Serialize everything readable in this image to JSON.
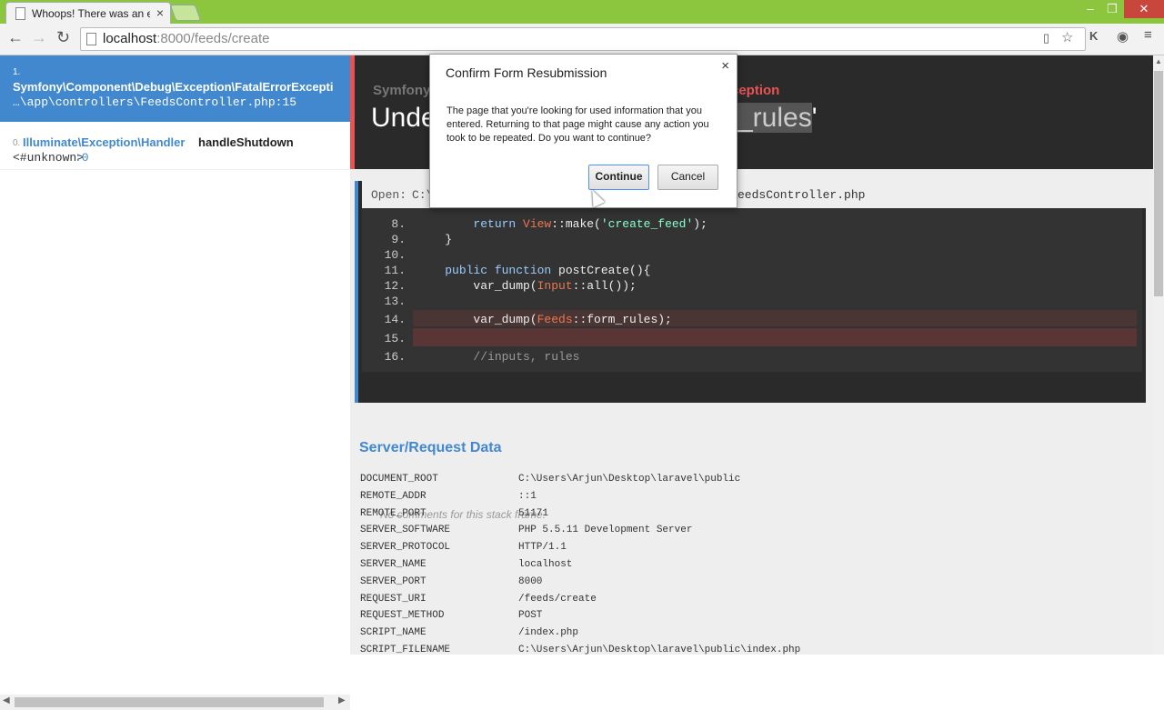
{
  "tab": {
    "title": "Whoops! There was an err"
  },
  "address": {
    "host": "localhost",
    "rest": ":8000/feeds/create"
  },
  "frames": [
    {
      "num": "1.",
      "cls": "Symfony\\Component\\Debug\\Exception\\FatalErrorExcepti",
      "file": "…\\app\\controllers\\FeedsController.php:15"
    },
    {
      "num": "0.",
      "cls": "Illuminate\\Exception\\Handler",
      "method": "handleShutdown",
      "file": "<#unknown>",
      "line": ":0"
    }
  ],
  "header": {
    "class_prefix": "Symfony",
    "class_suffix": "ception",
    "msg_prefix": "Unde",
    "msg_hl": "_rules",
    "msg_suffix": "'"
  },
  "open": {
    "label": "Open:",
    "path_prefix": "C:\\",
    "path_suffix": "eedsController.php"
  },
  "code": {
    "lines": [
      {
        "n": "8.",
        "parts": [
          [
            "",
            "        "
          ],
          [
            "kw",
            "return "
          ],
          [
            "cl",
            "View"
          ],
          [
            "",
            "::make("
          ],
          [
            "st",
            "'create_feed'"
          ],
          [
            "",
            ");"
          ]
        ]
      },
      {
        "n": "9.",
        "parts": [
          [
            "",
            "    }"
          ]
        ]
      },
      {
        "n": "10.",
        "parts": [
          [
            "",
            ""
          ]
        ]
      },
      {
        "n": "11.",
        "parts": [
          [
            "",
            "    "
          ],
          [
            "kw",
            "public function "
          ],
          [
            "",
            "postCreate(){"
          ]
        ]
      },
      {
        "n": "12.",
        "parts": [
          [
            "",
            "        var_dump("
          ],
          [
            "cl",
            "Input"
          ],
          [
            "",
            "::all());"
          ]
        ]
      },
      {
        "n": "13.",
        "parts": [
          [
            "",
            ""
          ]
        ]
      },
      {
        "n": "14.",
        "parts": [
          [
            "",
            "        var_dump("
          ],
          [
            "cl",
            "Feeds"
          ],
          [
            "",
            "::form_rules);"
          ]
        ]
      },
      {
        "n": "15.",
        "parts": [
          [
            "",
            ""
          ]
        ]
      },
      {
        "n": "16.",
        "parts": [
          [
            "",
            "        "
          ],
          [
            "cm",
            "//inputs, rules"
          ]
        ]
      }
    ]
  },
  "comments": "No comments for this stack frame.",
  "section_title": "Server/Request Data",
  "server_data": [
    [
      "DOCUMENT_ROOT",
      "C:\\Users\\Arjun\\Desktop\\laravel\\public"
    ],
    [
      "REMOTE_ADDR",
      "::1"
    ],
    [
      "REMOTE_PORT",
      "51171"
    ],
    [
      "SERVER_SOFTWARE",
      "PHP 5.5.11 Development Server"
    ],
    [
      "SERVER_PROTOCOL",
      "HTTP/1.1"
    ],
    [
      "SERVER_NAME",
      "localhost"
    ],
    [
      "SERVER_PORT",
      "8000"
    ],
    [
      "REQUEST_URI",
      "/feeds/create"
    ],
    [
      "REQUEST_METHOD",
      "POST"
    ],
    [
      "SCRIPT_NAME",
      "/index.php"
    ],
    [
      "SCRIPT_FILENAME",
      "C:\\Users\\Arjun\\Desktop\\laravel\\public\\index.php"
    ]
  ],
  "dialog": {
    "title": "Confirm Form Resubmission",
    "body": "The page that you're looking for used information that you entered. Returning to that page might cause any action you took to be repeated. Do you want to continue?",
    "continue": "Continue",
    "cancel": "Cancel"
  }
}
